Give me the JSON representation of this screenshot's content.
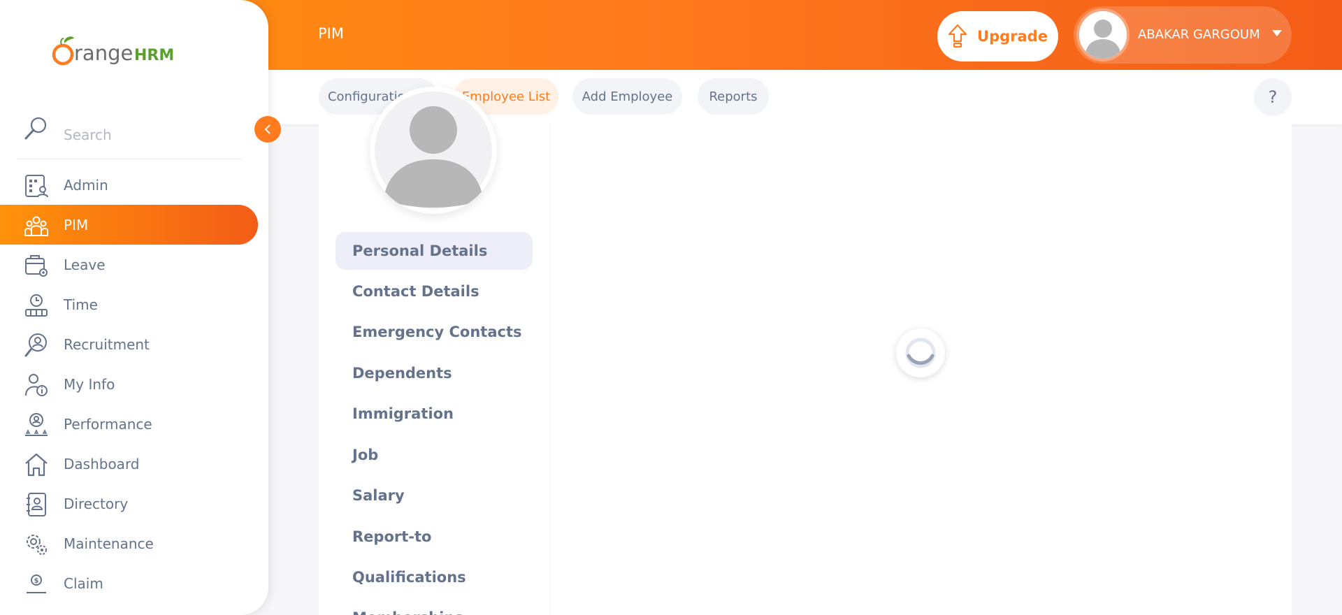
{
  "header": {
    "title": "PIM",
    "upgrade_label": "Upgrade",
    "user_name": "ABAKAR GARGOUM"
  },
  "logo": {
    "text_main": "range",
    "text_accent": "HRM"
  },
  "sidebar": {
    "search_placeholder": "Search",
    "items": [
      {
        "label": "Admin",
        "icon": "admin-icon"
      },
      {
        "label": "PIM",
        "icon": "pim-icon",
        "active": true
      },
      {
        "label": "Leave",
        "icon": "leave-icon"
      },
      {
        "label": "Time",
        "icon": "time-icon"
      },
      {
        "label": "Recruitment",
        "icon": "recruitment-icon"
      },
      {
        "label": "My Info",
        "icon": "my-info-icon"
      },
      {
        "label": "Performance",
        "icon": "performance-icon"
      },
      {
        "label": "Dashboard",
        "icon": "dashboard-icon"
      },
      {
        "label": "Directory",
        "icon": "directory-icon"
      },
      {
        "label": "Maintenance",
        "icon": "maintenance-icon"
      },
      {
        "label": "Claim",
        "icon": "claim-icon"
      }
    ]
  },
  "subnav": {
    "tabs": [
      {
        "label": "Configuration",
        "dropdown": true
      },
      {
        "label": "Employee List",
        "active": true
      },
      {
        "label": "Add Employee"
      },
      {
        "label": "Reports"
      }
    ],
    "help_label": "?"
  },
  "employee_menu": {
    "items": [
      "Personal Details",
      "Contact Details",
      "Emergency Contacts",
      "Dependents",
      "Immigration",
      "Job",
      "Salary",
      "Report-to",
      "Qualifications",
      "Memberships"
    ],
    "active_index": 0
  },
  "colors": {
    "brand_orange": "#ff7b1d",
    "header_start": "#ff920b",
    "header_end": "#f35c17",
    "text": "#64728c",
    "logo_green": "#5aa02c"
  }
}
